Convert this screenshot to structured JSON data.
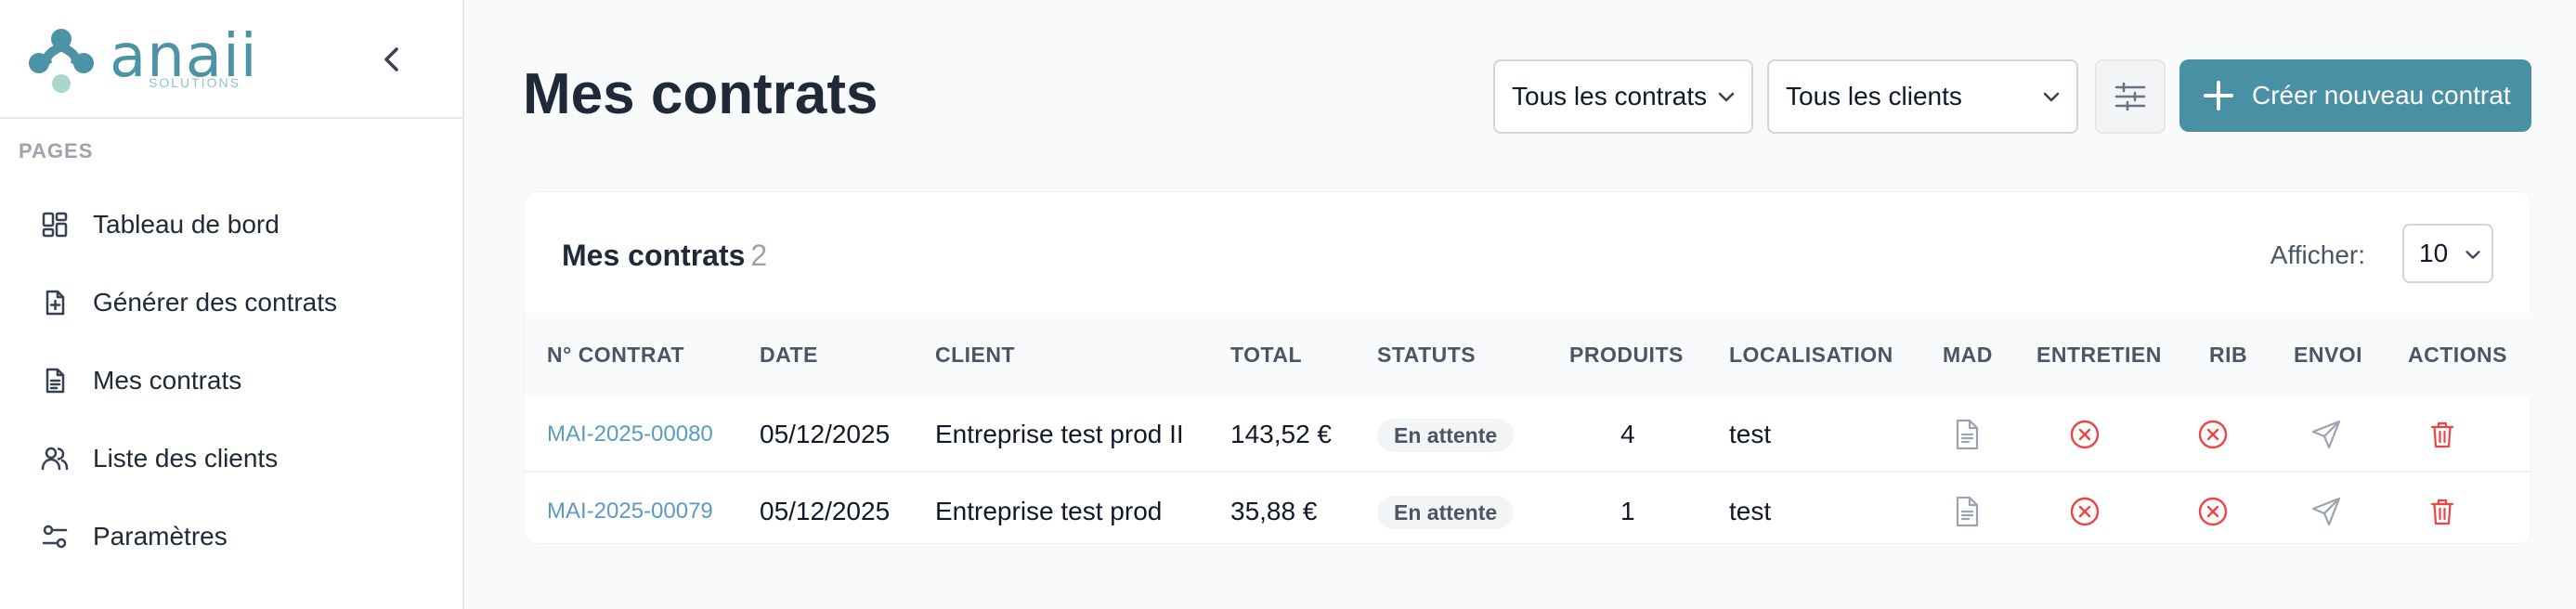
{
  "brand": {
    "name": "anaii",
    "sub": "SOLUTIONS"
  },
  "sidebar": {
    "section": "PAGES",
    "items": [
      {
        "label": "Tableau de bord",
        "icon": "dashboard-icon"
      },
      {
        "label": "Générer des contrats",
        "icon": "file-plus-icon"
      },
      {
        "label": "Mes contrats",
        "icon": "file-text-icon"
      },
      {
        "label": "Liste des clients",
        "icon": "users-icon"
      },
      {
        "label": "Paramètres",
        "icon": "settings-sliders-icon"
      }
    ]
  },
  "header": {
    "title": "Mes contrats",
    "filter_contracts": "Tous les contrats",
    "filter_clients": "Tous les clients",
    "create_label": "Créer nouveau contrat"
  },
  "card": {
    "title": "Mes contrats",
    "count": "2",
    "show_label": "Afficher:",
    "show_value": "10"
  },
  "table": {
    "columns": [
      "N° CONTRAT",
      "DATE",
      "CLIENT",
      "TOTAL",
      "STATUTS",
      "PRODUITS",
      "LOCALISATION",
      "MAD",
      "ENTRETIEN",
      "RIB",
      "ENVOI",
      "ACTIONS"
    ],
    "rows": [
      {
        "numero": "MAI-2025-00080",
        "date": "05/12/2025",
        "client": "Entreprise test prod II",
        "total": "143,52 €",
        "statut": "En attente",
        "produits": "4",
        "localisation": "test"
      },
      {
        "numero": "MAI-2025-00079",
        "date": "05/12/2025",
        "client": "Entreprise test prod",
        "total": "35,88 €",
        "statut": "En attente",
        "produits": "1",
        "localisation": "test"
      }
    ]
  },
  "colors": {
    "accent": "#4a90a4",
    "danger": "#ef4444",
    "link": "#5b9bc2"
  }
}
